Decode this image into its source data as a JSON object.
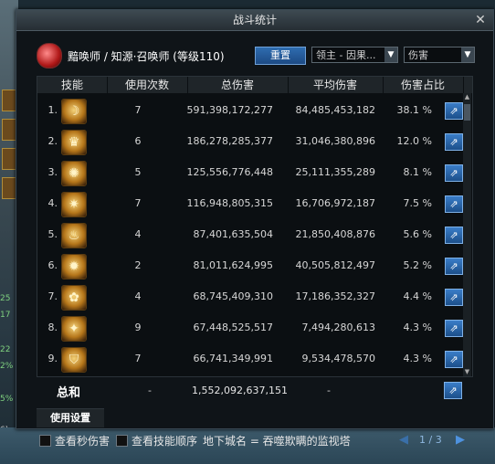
{
  "window": {
    "title": "战斗统计",
    "close_label": "✕"
  },
  "header": {
    "char_info": "黯唤师 / 知源·召唤师 (等级110)",
    "reset_label": "重置",
    "target_select": "领主 - 因果...",
    "mode_select": "伤害"
  },
  "table": {
    "columns": [
      "技能",
      "使用次数",
      "总伤害",
      "平均伤害",
      "伤害占比"
    ],
    "rows": [
      {
        "rank": "1.",
        "count": "7",
        "total": "591,398,172,277",
        "avg": "84,485,453,182",
        "pct": "38.1 %",
        "icon": "crescent-icon"
      },
      {
        "rank": "2.",
        "count": "6",
        "total": "186,278,285,377",
        "avg": "31,046,380,896",
        "pct": "12.0 %",
        "icon": "crown-icon"
      },
      {
        "rank": "3.",
        "count": "5",
        "total": "125,556,776,448",
        "avg": "25,111,355,289",
        "pct": "8.1 %",
        "icon": "rune-icon"
      },
      {
        "rank": "4.",
        "count": "7",
        "total": "116,948,805,315",
        "avg": "16,706,972,187",
        "pct": "7.5 %",
        "icon": "starburst-icon"
      },
      {
        "rank": "5.",
        "count": "4",
        "total": "87,401,635,504",
        "avg": "21,850,408,876",
        "pct": "5.6 %",
        "icon": "flame-icon"
      },
      {
        "rank": "6.",
        "count": "2",
        "total": "81,011,624,995",
        "avg": "40,505,812,497",
        "pct": "5.2 %",
        "icon": "beast-icon"
      },
      {
        "rank": "7.",
        "count": "4",
        "total": "68,745,409,310",
        "avg": "17,186,352,327",
        "pct": "4.4 %",
        "icon": "flower-icon"
      },
      {
        "rank": "8.",
        "count": "9",
        "total": "67,448,525,517",
        "avg": "7,494,280,613",
        "pct": "4.3 %",
        "icon": "slash-icon"
      },
      {
        "rank": "9.",
        "count": "7",
        "total": "66,741,349,991",
        "avg": "9,534,478,570",
        "pct": "4.3 %",
        "icon": "shield-icon"
      }
    ]
  },
  "summary": {
    "label": "总和",
    "count": "-",
    "total": "1,552,092,637,151",
    "avg": "-"
  },
  "settings_tab": "使用设置",
  "footer": {
    "dps_label": "查看秒伤害",
    "order_label": "查看技能顺序",
    "dungeon_label": "地下城名 = 吞噬欺瞒的监视塔",
    "page": "1 / 3"
  },
  "background": {
    "stats": [
      "25",
      "17",
      "22",
      "2%",
      "5%",
      "6)"
    ]
  }
}
